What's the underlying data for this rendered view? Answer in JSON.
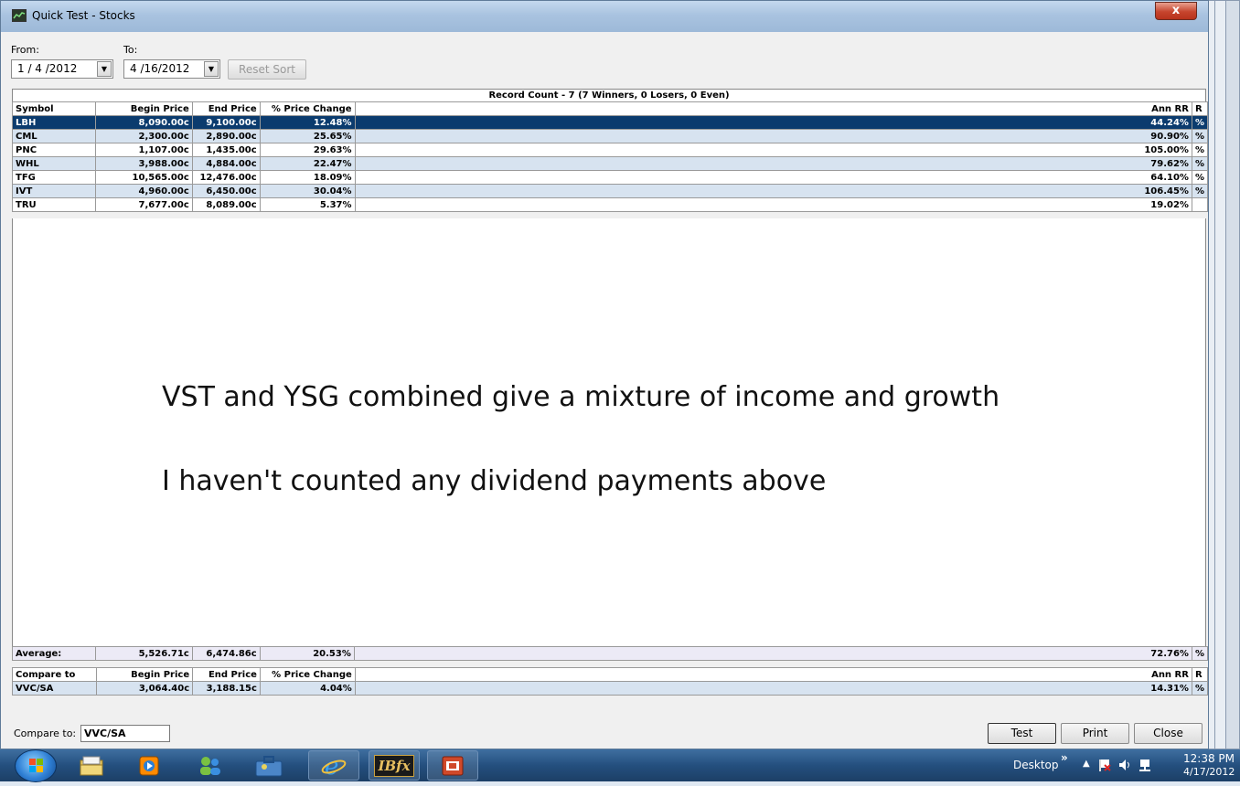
{
  "window": {
    "title": "Quick Test - Stocks",
    "close_glyph": "x"
  },
  "filters": {
    "from_label": "From:",
    "to_label": "To:",
    "from_value": "1 / 4 /2012",
    "to_value": "4 /16/2012",
    "reset_sort": "Reset Sort"
  },
  "record_count": "Record Count - 7  (7 Winners, 0 Losers, 0 Even)",
  "columns": [
    "Symbol",
    "Begin Price",
    "End Price",
    "% Price Change",
    "Ann RR",
    "R"
  ],
  "rows": [
    {
      "symbol": "LBH",
      "begin": "8,090.00c",
      "end": "9,100.00c",
      "change": "12.48%",
      "ann": "44.24%",
      "r": "%"
    },
    {
      "symbol": "CML",
      "begin": "2,300.00c",
      "end": "2,890.00c",
      "change": "25.65%",
      "ann": "90.90%",
      "r": "%"
    },
    {
      "symbol": "PNC",
      "begin": "1,107.00c",
      "end": "1,435.00c",
      "change": "29.63%",
      "ann": "105.00%",
      "r": "%"
    },
    {
      "symbol": "WHL",
      "begin": "3,988.00c",
      "end": "4,884.00c",
      "change": "22.47%",
      "ann": "79.62%",
      "r": "%"
    },
    {
      "symbol": "TFG",
      "begin": "10,565.00c",
      "end": "12,476.00c",
      "change": "18.09%",
      "ann": "64.10%",
      "r": "%"
    },
    {
      "symbol": "IVT",
      "begin": "4,960.00c",
      "end": "6,450.00c",
      "change": "30.04%",
      "ann": "106.45%",
      "r": "%"
    },
    {
      "symbol": "TRU",
      "begin": "7,677.00c",
      "end": "8,089.00c",
      "change": "5.37%",
      "ann": "19.02%",
      "r": ""
    }
  ],
  "overlay": {
    "line1": "VST and YSG combined give a mixture of income and growth",
    "line2": "I haven't counted any dividend payments above"
  },
  "average": {
    "label": "Average:",
    "begin": "5,526.71c",
    "end": "6,474.86c",
    "change": "20.53%",
    "ann": "72.76%",
    "r": "%"
  },
  "compare_header": [
    "Compare to",
    "Begin Price",
    "End Price",
    "% Price Change",
    "Ann RR",
    "R"
  ],
  "compare_row": {
    "symbol": "VVC/SA",
    "begin": "3,064.40c",
    "end": "3,188.15c",
    "change": "4.04%",
    "ann": "14.31%",
    "r": "%"
  },
  "compare_input": {
    "label": "Compare to:",
    "value": "VVC/SA"
  },
  "buttons": {
    "test": "Test",
    "print": "Print",
    "close": "Close"
  },
  "taskbar": {
    "desktop": "Desktop",
    "chevron": "»",
    "time": "12:38 PM",
    "date": "4/17/2012",
    "ibfx": "IBfx"
  },
  "colors": {
    "selected_row": "#0b3b6e",
    "alt_row": "#d7e3f0",
    "taskbar": "#244f7e"
  }
}
